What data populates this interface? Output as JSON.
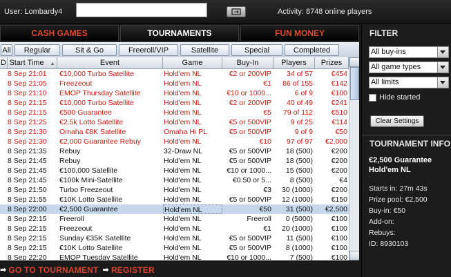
{
  "topbar": {
    "user_label": "User: Lombardy4",
    "activity": "Activity: 8748 online players"
  },
  "main_tabs": [
    "CASH GAMES",
    "TOURNAMENTS",
    "FUN MONEY"
  ],
  "sub_tabs": [
    "All",
    "Regular",
    "Sit & Go",
    "Freeroll/VIP",
    "Satellite",
    "Special",
    "Completed"
  ],
  "table": {
    "headers": [
      "D",
      "Start Time",
      "Event",
      "Game",
      "Buy-In",
      "Players",
      "Prizes"
    ],
    "rows": [
      {
        "d": "",
        "start": "8 Sep 21:01",
        "event": "€10,000 Turbo Satellite",
        "game": "Hold'em NL",
        "buyin": "€2 or 200VIP",
        "players": "34 of 57",
        "prizes": "€454",
        "color": "red"
      },
      {
        "d": "",
        "start": "8 Sep 21:05",
        "event": "Freezeout",
        "game": "Hold'em NL",
        "buyin": "€1",
        "players": "86 of 155",
        "prizes": "€142",
        "color": "red"
      },
      {
        "d": "",
        "start": "8 Sep 21:10",
        "event": "EMOP Thursday Satellite",
        "game": "Hold'em NL",
        "buyin": "€10 or 1000...",
        "players": "6 of 9",
        "prizes": "€100",
        "color": "red"
      },
      {
        "d": "",
        "start": "8 Sep 21:15",
        "event": "€10,000 Turbo Satellite",
        "game": "Hold'em NL",
        "buyin": "€2 or 200VIP",
        "players": "40 of 49",
        "prizes": "€241",
        "color": "red"
      },
      {
        "d": "",
        "start": "8 Sep 21:15",
        "event": "€500 Guarantee",
        "game": "Hold'em NL",
        "buyin": "€5",
        "players": "79 of 112",
        "prizes": "€510",
        "color": "red"
      },
      {
        "d": "",
        "start": "8 Sep 21:25",
        "event": "€2.5k Lotto Satellite",
        "game": "Hold'em NL",
        "buyin": "€5 or 500VIP",
        "players": "9 of 25",
        "prizes": "€114",
        "color": "red"
      },
      {
        "d": "",
        "start": "8 Sep 21:30",
        "event": "Omaha €8K Satellite",
        "game": "Omaha Hi PL",
        "buyin": "€5 or 500VIP",
        "players": "9 of 9",
        "prizes": "€50",
        "color": "red"
      },
      {
        "d": "",
        "start": "8 Sep 21:30",
        "event": "€2,000 Guarantee Rebuy",
        "game": "Hold'em NL",
        "buyin": "€10",
        "players": "97 of 97",
        "prizes": "€2,000",
        "color": "red"
      },
      {
        "d": "",
        "start": "8 Sep 21:35",
        "event": "Rebuy",
        "game": "32-Draw NL",
        "buyin": "€5 or 500VIP",
        "players": "18 (500)",
        "prizes": "€200",
        "color": "black"
      },
      {
        "d": "",
        "start": "8 Sep 21:45",
        "event": "Rebuy",
        "game": "Hold'em NL",
        "buyin": "€5 or 500VIP",
        "players": "18 (500)",
        "prizes": "€200",
        "color": "black"
      },
      {
        "d": "",
        "start": "8 Sep 21:45",
        "event": "€100,000 Satellite",
        "game": "Hold'em NL",
        "buyin": "€10 or 1000...",
        "players": "15 (500)",
        "prizes": "€200",
        "color": "black"
      },
      {
        "d": "",
        "start": "8 Sep 21:45",
        "event": "€100k Mini-Satellite",
        "game": "Hold'em NL",
        "buyin": "€0.50 or 5...",
        "players": "8 (500)",
        "prizes": "€4",
        "color": "black"
      },
      {
        "d": "",
        "start": "8 Sep 21:50",
        "event": "Turbo Freezeout",
        "game": "Hold'em NL",
        "buyin": "€3",
        "players": "30 (1000)",
        "prizes": "€200",
        "color": "black"
      },
      {
        "d": "",
        "start": "8 Sep 21:55",
        "event": "€10K Lotto Satellite",
        "game": "Hold'em NL",
        "buyin": "€5 or 500VIP",
        "players": "12 (1000)",
        "prizes": "€150",
        "color": "black"
      },
      {
        "d": "",
        "start": "8 Sep 22:00",
        "event": "€2,500 Guarantee",
        "game": "Hold'em NL",
        "buyin": "€50",
        "players": "31 (500)",
        "prizes": "€2,500",
        "color": "black",
        "selected": true
      },
      {
        "d": "",
        "start": "8 Sep 22:15",
        "event": "Freeroll",
        "game": "Hold'em NL",
        "buyin": "Freeroll",
        "players": "0 (5000)",
        "prizes": "€100",
        "color": "black"
      },
      {
        "d": "",
        "start": "8 Sep 22:15",
        "event": "Freezeout",
        "game": "Hold'em NL",
        "buyin": "€1",
        "players": "20 (1000)",
        "prizes": "€100",
        "color": "black"
      },
      {
        "d": "",
        "start": "8 Sep 22:15",
        "event": "Sunday €35K Satellite",
        "game": "Hold'em NL",
        "buyin": "€5 or 500VIP",
        "players": "11 (500)",
        "prizes": "€100",
        "color": "black"
      },
      {
        "d": "",
        "start": "8 Sep 22:15",
        "event": "€10K Lotto Satellite",
        "game": "Hold'em NL",
        "buyin": "€5 or 500VIP",
        "players": "8 (1000)",
        "prizes": "€100",
        "color": "black"
      },
      {
        "d": "",
        "start": "8 Sep 22:20",
        "event": "EMOP Tuesday Satellite",
        "game": "Hold'em NL",
        "buyin": "€10 or 1000...",
        "players": "7 (500)",
        "prizes": "€100",
        "color": "black"
      }
    ]
  },
  "bottom": {
    "goto": "GO TO TOURNAMENT",
    "register": "REGISTER"
  },
  "filter": {
    "title": "FILTER",
    "buyins": "All buy-ins",
    "game_types": "All game types",
    "limits": "All limits",
    "hide_started": "Hide started",
    "clear": "Clear Settings"
  },
  "info": {
    "title": "TOURNAMENT INFO",
    "name1": "€2,500 Guarantee",
    "name2": "Hold'em NL",
    "starts": "Starts in: 27m 43s",
    "prize": "Prize pool: €2,500",
    "buyin": "Buy-in: €50",
    "addon": "Add-on:",
    "rebuys": "Rebuys:",
    "id": "ID: 8930103"
  }
}
